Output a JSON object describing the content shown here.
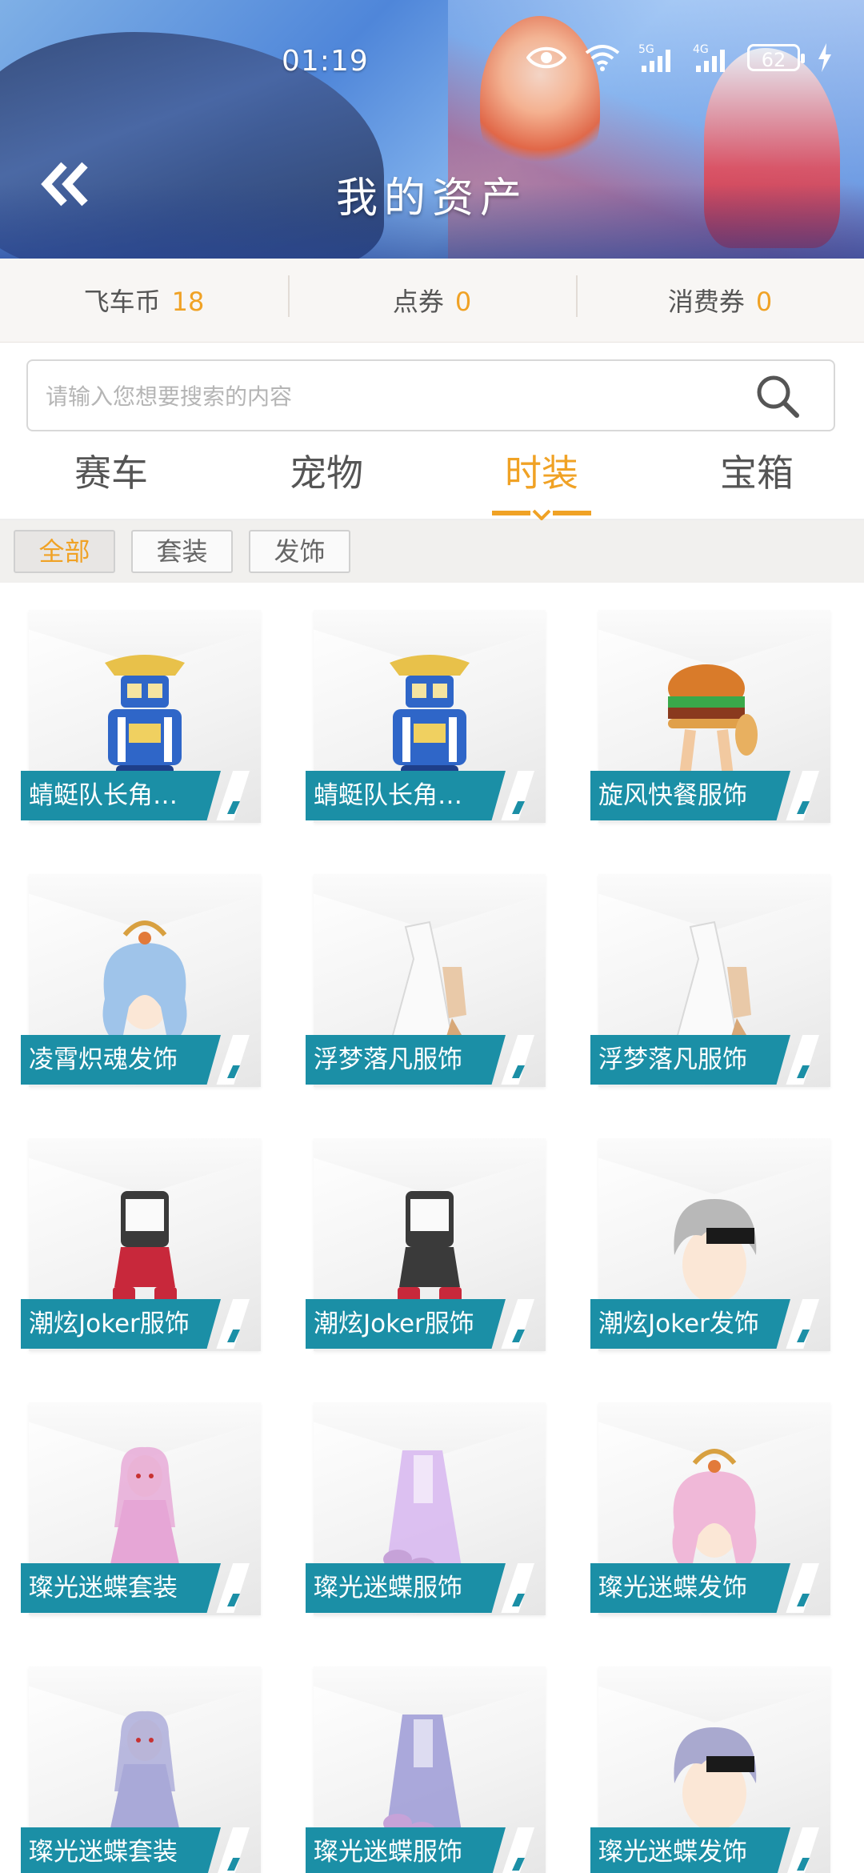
{
  "status_bar": {
    "time": "01:19",
    "network_5g": "5G",
    "network_4g": "4G",
    "battery": "62"
  },
  "header": {
    "title": "我的资产"
  },
  "currencies": [
    {
      "label": "飞车币",
      "value": "18"
    },
    {
      "label": "点券",
      "value": "0"
    },
    {
      "label": "消费券",
      "value": "0"
    }
  ],
  "search": {
    "placeholder": "请输入您想要搜索的内容",
    "value": ""
  },
  "tabs": [
    {
      "label": "赛车",
      "active": false
    },
    {
      "label": "宠物",
      "active": false
    },
    {
      "label": "时装",
      "active": true
    },
    {
      "label": "宝箱",
      "active": false
    }
  ],
  "filters": [
    {
      "label": "全部",
      "active": true
    },
    {
      "label": "套装",
      "active": false
    },
    {
      "label": "发饰",
      "active": false
    }
  ],
  "items": [
    {
      "name": "蜻蜓队长角色…",
      "icon": "robot-character-icon",
      "color": "#2f66c8"
    },
    {
      "name": "蜻蜓队长角色…",
      "icon": "robot-character-icon",
      "color": "#2f66c8"
    },
    {
      "name": "旋风快餐服饰",
      "icon": "burger-outfit-icon",
      "color": "#d97b2a"
    },
    {
      "name": "凌霄炽魂发饰",
      "icon": "hair-accessory-icon",
      "color": "#9fc4ea"
    },
    {
      "name": "浮梦落凡服饰",
      "icon": "white-dress-icon",
      "color": "#e9c9a8"
    },
    {
      "name": "浮梦落凡服饰",
      "icon": "white-dress-icon",
      "color": "#e9c9a8"
    },
    {
      "name": "潮炫Joker服饰",
      "icon": "joker-outfit-icon",
      "color": "#c8283b"
    },
    {
      "name": "潮炫Joker服饰",
      "icon": "joker-outfit-icon",
      "color": "#3a3a3a"
    },
    {
      "name": "潮炫Joker发饰",
      "icon": "silver-hair-icon",
      "color": "#b8b8b8"
    },
    {
      "name": "璨光迷蝶套装",
      "icon": "pink-suit-icon",
      "color": "#e6a6d6"
    },
    {
      "name": "璨光迷蝶服饰",
      "icon": "pink-dress-icon",
      "color": "#d7b6f0"
    },
    {
      "name": "璨光迷蝶发饰",
      "icon": "pink-hair-icon",
      "color": "#f0b8d8"
    },
    {
      "name": "璨光迷蝶套装",
      "icon": "lilac-suit-icon",
      "color": "#a9a9d8"
    },
    {
      "name": "璨光迷蝶服饰",
      "icon": "lilac-outfit-icon",
      "color": "#9c9ad6"
    },
    {
      "name": "璨光迷蝶发饰",
      "icon": "lilac-hair-icon",
      "color": "#a9a9cf"
    }
  ]
}
